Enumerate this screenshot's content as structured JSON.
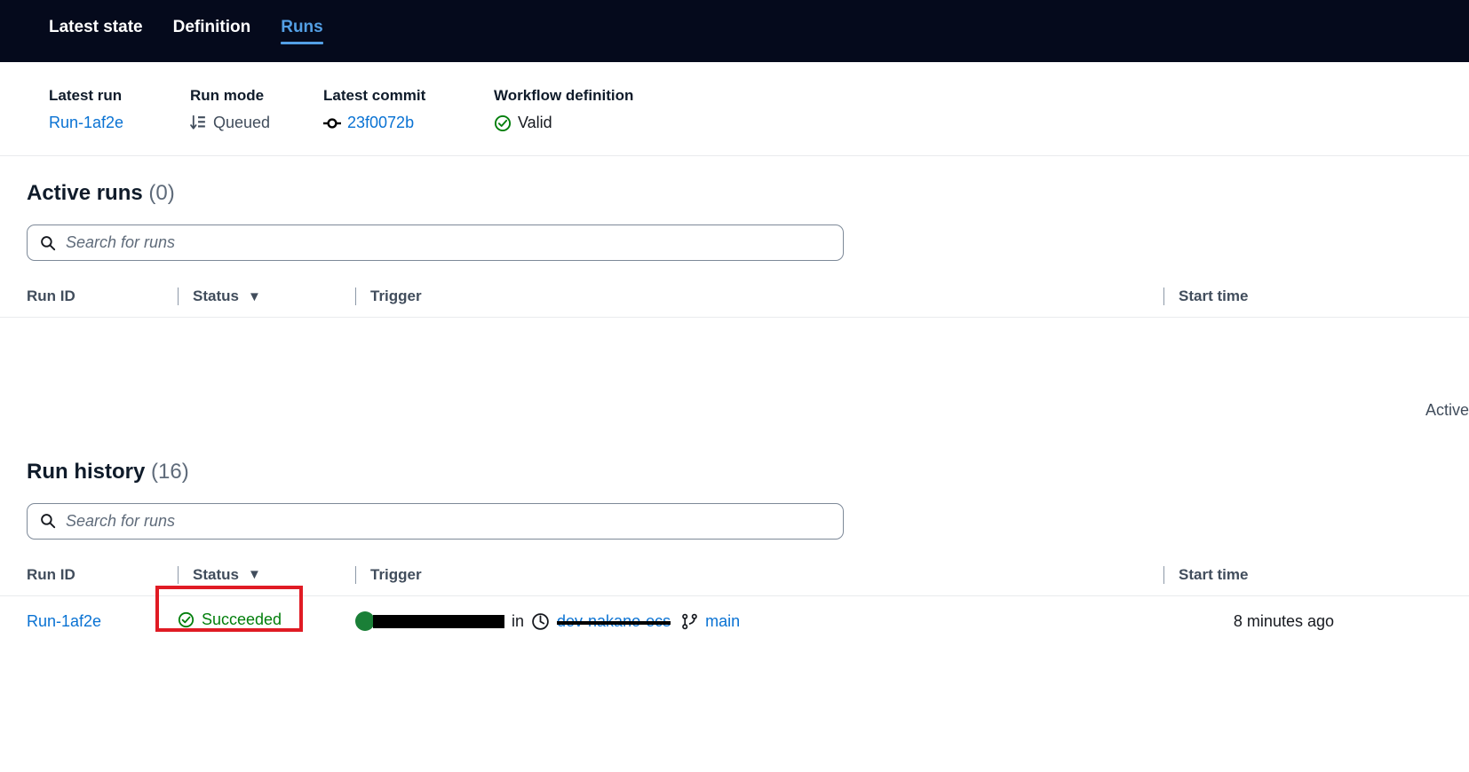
{
  "tabs": [
    {
      "label": "Latest state",
      "active": false
    },
    {
      "label": "Definition",
      "active": false
    },
    {
      "label": "Runs",
      "active": true
    }
  ],
  "summary": {
    "latest_run": {
      "label": "Latest run",
      "value": "Run-1af2e"
    },
    "run_mode": {
      "label": "Run mode",
      "value": "Queued",
      "icon": "queue-icon"
    },
    "latest_commit": {
      "label": "Latest commit",
      "value": "23f0072b",
      "icon": "git-commit-icon"
    },
    "workflow_definition": {
      "label": "Workflow definition",
      "value": "Valid",
      "icon": "check-circle-icon",
      "color": "#037f0c"
    }
  },
  "active_runs": {
    "title": "Active runs",
    "count": "(0)",
    "search_placeholder": "Search for runs",
    "columns": {
      "run_id": "Run ID",
      "status": "Status",
      "trigger": "Trigger",
      "start_time": "Start time"
    },
    "empty_text": "Active"
  },
  "run_history": {
    "title": "Run history",
    "count": "(16)",
    "search_placeholder": "Search for runs",
    "columns": {
      "run_id": "Run ID",
      "status": "Status",
      "trigger": "Trigger",
      "start_time": "Start time"
    },
    "rows": [
      {
        "run_id": "Run-1af2e",
        "status": "Succeeded",
        "status_color": "#037f0c",
        "trigger_user": "",
        "trigger_in": "in",
        "trigger_repo": "dev-nakano-ecs",
        "trigger_branch": "main",
        "start_time": "8 minutes ago",
        "highlighted": true
      }
    ]
  },
  "colors": {
    "accent_link": "#0972d3",
    "tab_active": "#539fe5",
    "header_bg": "#050a1c",
    "success_green": "#037f0c",
    "highlight_red": "#e01b24"
  }
}
